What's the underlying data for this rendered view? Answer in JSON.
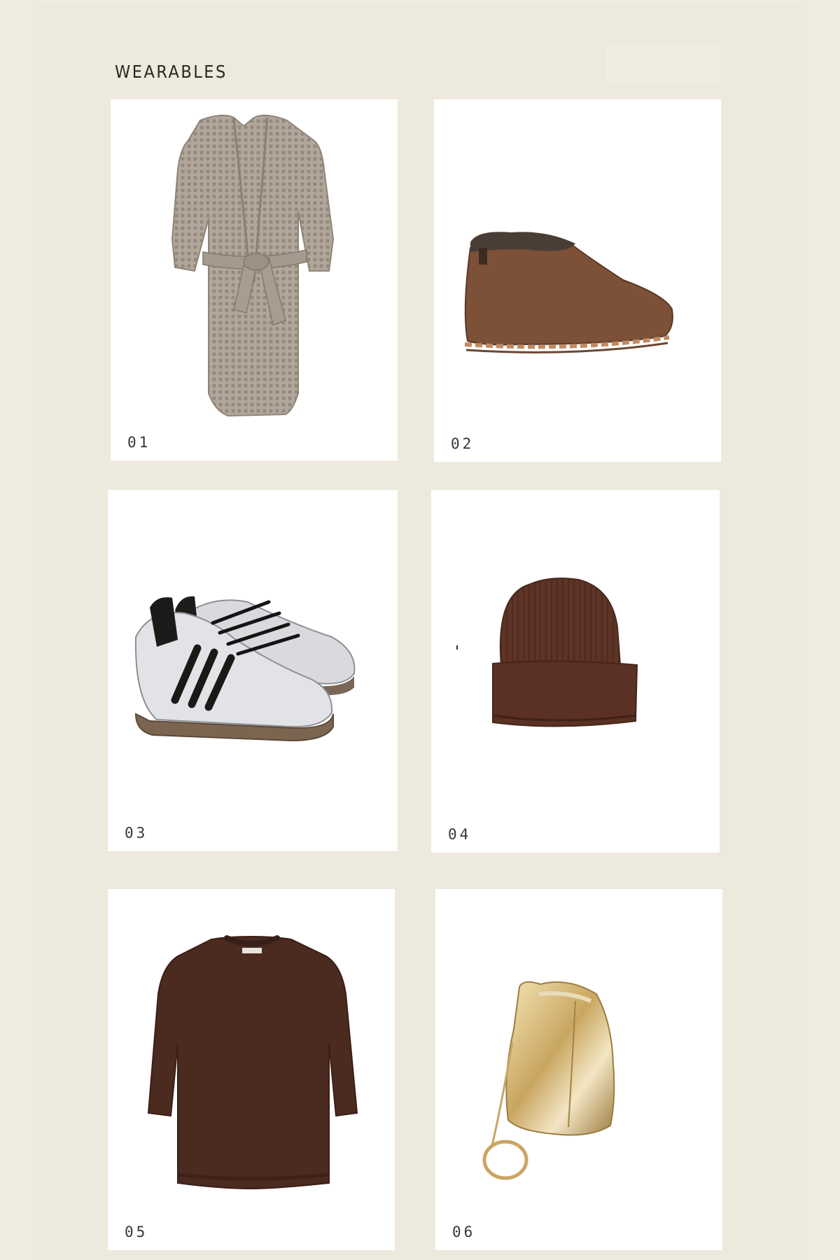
{
  "section": {
    "title": "WEARABLES"
  },
  "products": [
    {
      "num": "01",
      "item": "waffle-knit robe",
      "color": "#a89d92"
    },
    {
      "num": "02",
      "item": "shearling bootie slipper",
      "color": "#7a4f36"
    },
    {
      "num": "03",
      "item": "silver striped sneakers",
      "color": "#d8d9db"
    },
    {
      "num": "04",
      "item": "brown knit beanie",
      "color": "#5c3226"
    },
    {
      "num": "05",
      "item": "brown crewneck sweater",
      "color": "#4a291f"
    },
    {
      "num": "06",
      "item": "gold metallic bucket bag",
      "color": "#d9c28e"
    }
  ]
}
